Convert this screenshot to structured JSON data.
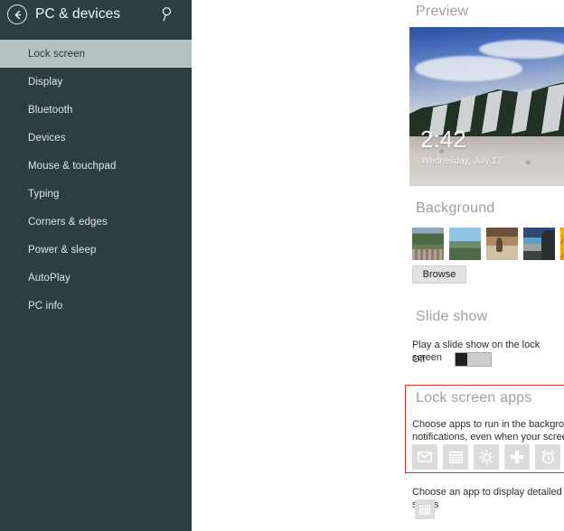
{
  "sidebar": {
    "back_icon": "back-arrow-icon",
    "title": "PC & devices",
    "search_icon": "search-icon",
    "items": [
      {
        "label": "Lock screen",
        "selected": true
      },
      {
        "label": "Display",
        "selected": false
      },
      {
        "label": "Bluetooth",
        "selected": false
      },
      {
        "label": "Devices",
        "selected": false
      },
      {
        "label": "Mouse & touchpad",
        "selected": false
      },
      {
        "label": "Typing",
        "selected": false
      },
      {
        "label": "Corners & edges",
        "selected": false
      },
      {
        "label": "Power & sleep",
        "selected": false
      },
      {
        "label": "AutoPlay",
        "selected": false
      },
      {
        "label": "PC info",
        "selected": false
      }
    ]
  },
  "main": {
    "preview": {
      "heading": "Preview",
      "clock_time": "2:42",
      "clock_date": "Wednesday, July 17"
    },
    "background": {
      "heading": "Background",
      "thumbnails": [
        {
          "name": "mountain-village-thumbnail"
        },
        {
          "name": "blue-sky-mountains-thumbnail"
        },
        {
          "name": "market-scene-thumbnail"
        },
        {
          "name": "coastal-view-thumbnail"
        },
        {
          "name": "orange-petal-thumbnail"
        }
      ],
      "browse_label": "Browse"
    },
    "slide_show": {
      "heading": "Slide show",
      "description": "Play a slide show on the lock screen",
      "toggle_state": "Off"
    },
    "lock_screen_apps": {
      "heading": "Lock screen apps",
      "description": "Choose apps to run in the background and show quick status and notifications, even when your screen is locked",
      "apps": [
        {
          "icon": "mail-icon"
        },
        {
          "icon": "calendar-icon"
        },
        {
          "icon": "weather-sun-icon"
        },
        {
          "icon": "health-cross-icon"
        },
        {
          "icon": "alarm-clock-icon"
        },
        {
          "icon": "add-plus-icon",
          "glyph": "+"
        },
        {
          "icon": "add-plus-icon",
          "glyph": "+"
        }
      ]
    },
    "detailed_status": {
      "label": "Choose an app to display detailed status",
      "app_icon": "calendar-icon"
    }
  },
  "colors": {
    "sidebar_bg": "#2c3e42",
    "sidebar_selected": "#b6c2c2",
    "heading_gray": "#9aa0a3",
    "highlight_red": "#e03030",
    "tile_gray": "#dcdcdc"
  }
}
